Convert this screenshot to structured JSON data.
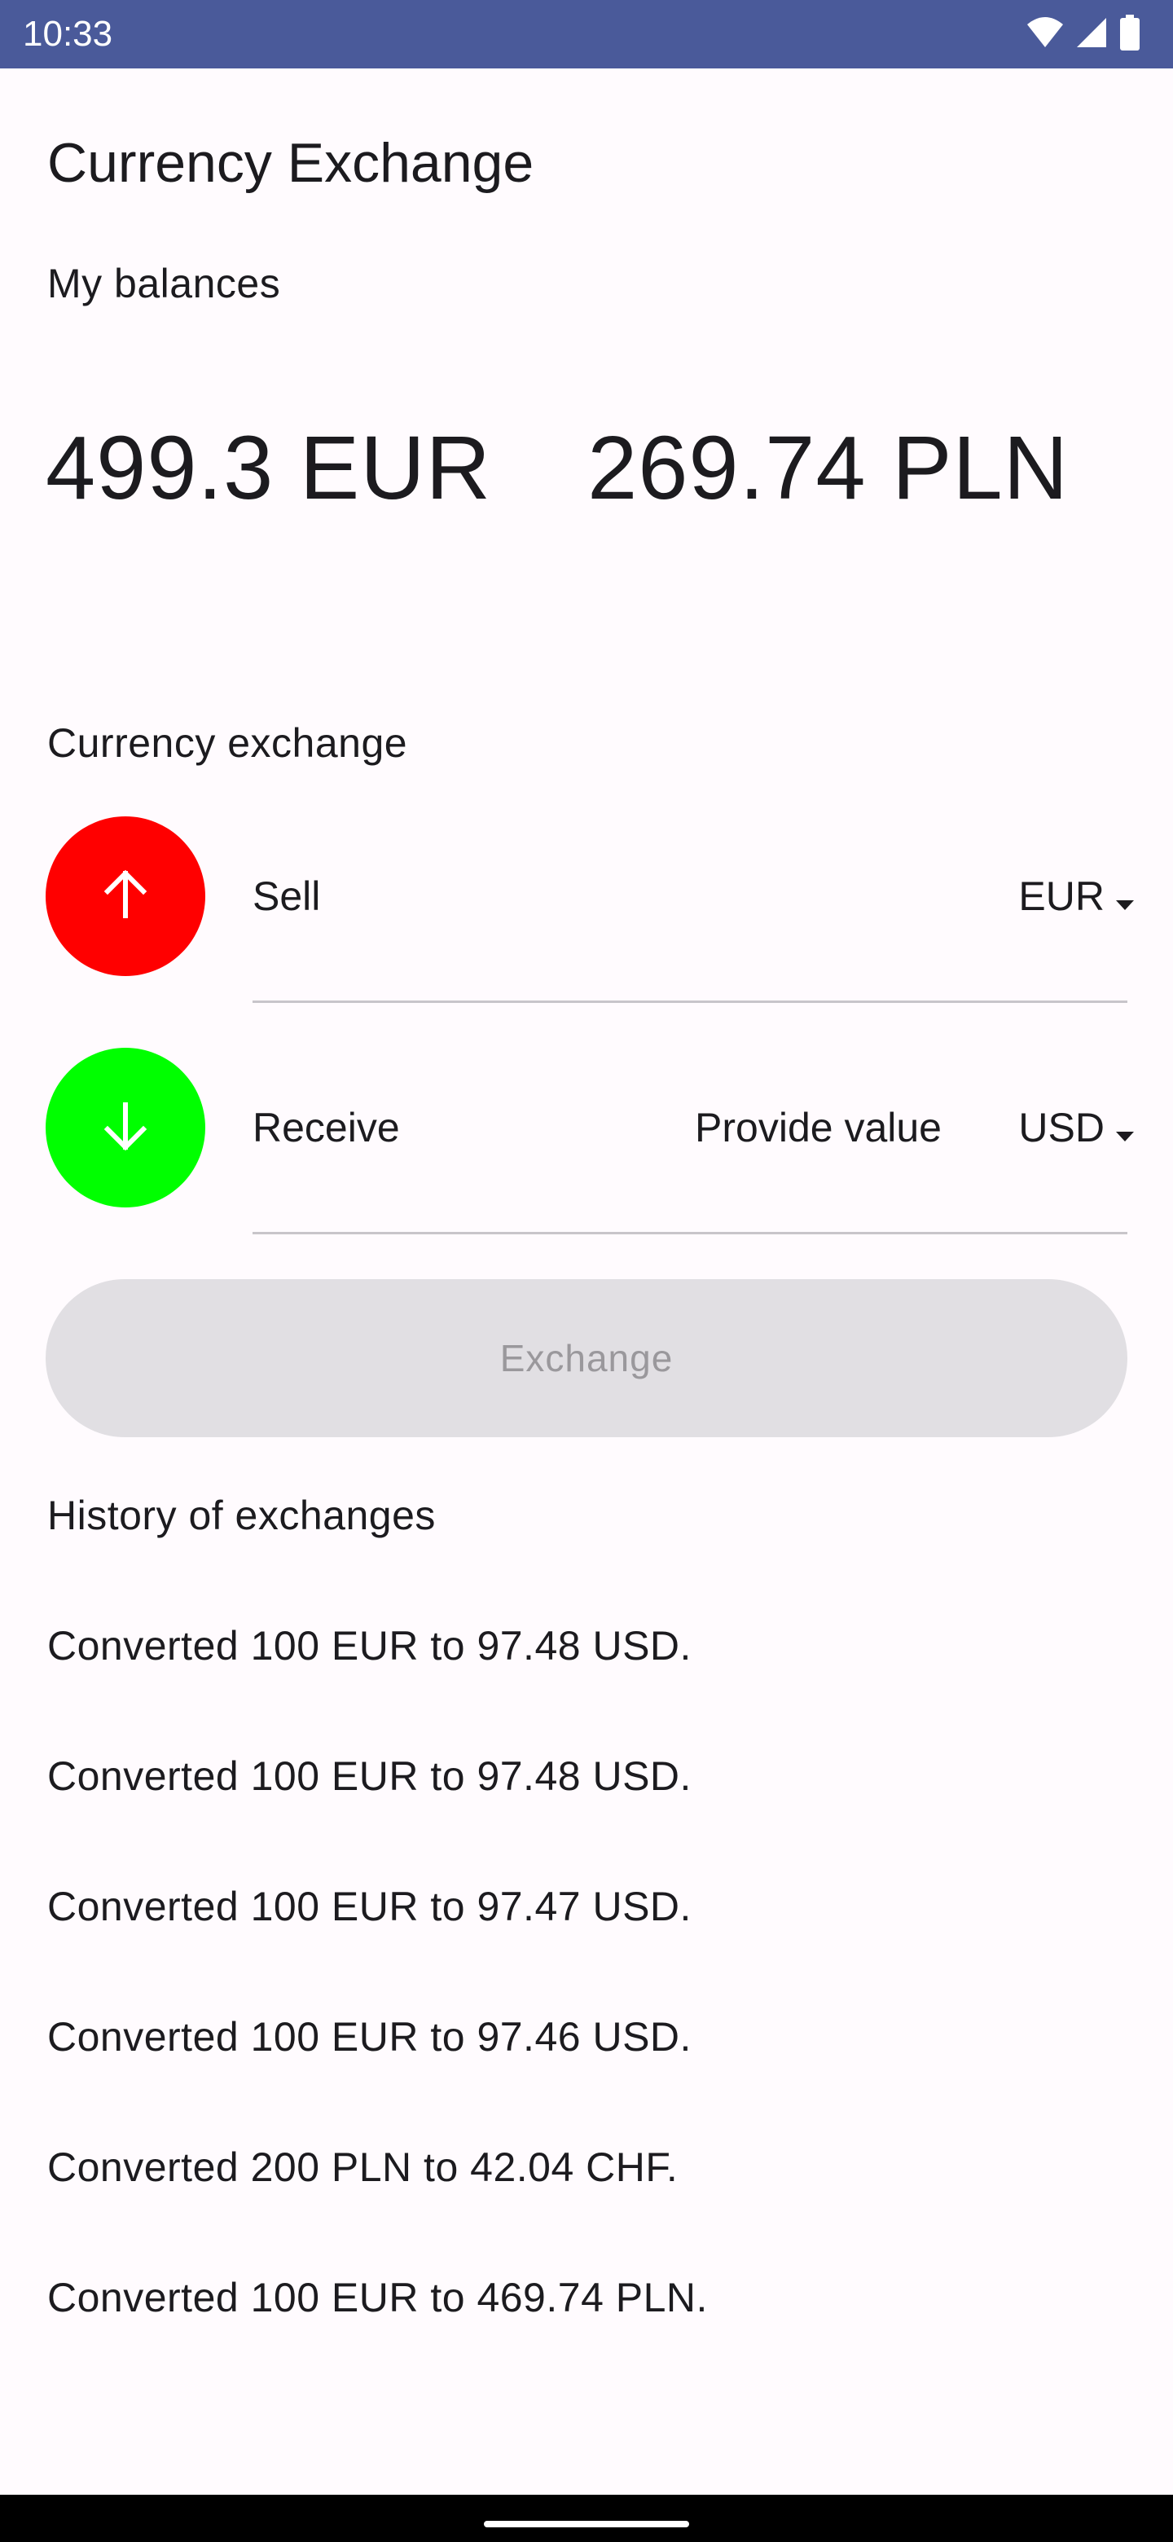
{
  "status_bar": {
    "time": "10:33",
    "icons": [
      "wifi-icon",
      "signal-icon",
      "battery-icon"
    ]
  },
  "app": {
    "title": "Currency Exchange"
  },
  "balances": {
    "label": "My balances",
    "items": [
      "499.3 EUR",
      "269.74 PLN"
    ]
  },
  "exchange": {
    "label": "Currency exchange",
    "sell": {
      "icon": "arrow-up-icon",
      "color": "#ff0000",
      "label": "Sell",
      "value": "",
      "currency": "EUR"
    },
    "receive": {
      "icon": "arrow-down-icon",
      "color": "#00ff00",
      "label": "Receive",
      "placeholder": "Provide value",
      "currency": "USD"
    },
    "button_label": "Exchange"
  },
  "history": {
    "label": "History of exchanges",
    "items": [
      "Converted 100 EUR to 97.48 USD.",
      "Converted 100 EUR to 97.48 USD.",
      "Converted 100 EUR to 97.47 USD.",
      "Converted 100 EUR to 97.46 USD.",
      "Converted 200 PLN to 42.04 CHF.",
      "Converted 100 EUR to 469.74 PLN."
    ]
  }
}
